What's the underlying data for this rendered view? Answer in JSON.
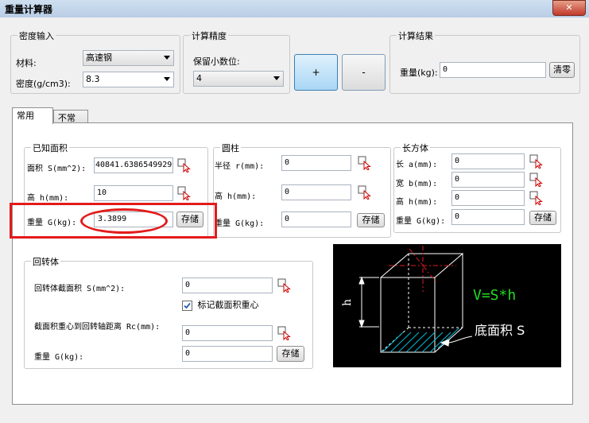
{
  "window": {
    "title": "重量计算器",
    "close": "✕"
  },
  "density": {
    "legend": "密度输入",
    "material_label": "材料:",
    "material_value": "高速钢",
    "density_label": "密度(g/cm3):",
    "density_value": "8.3"
  },
  "precision": {
    "legend": "计算精度",
    "decimals_label": "保留小数位:",
    "decimals_value": "4"
  },
  "ops": {
    "plus": "+",
    "minus": "-"
  },
  "result": {
    "legend": "计算结果",
    "weight_label": "重量(kg):",
    "weight_value": "0",
    "clear_label": "清零"
  },
  "tabs": [
    {
      "label": "常用"
    },
    {
      "label": "不常用"
    }
  ],
  "known_area": {
    "legend": "已知面积",
    "area_label": "面积 S(mm^2):",
    "area_value": "40841.6386549929",
    "height_label": "高 h(mm):",
    "height_value": "10",
    "weight_label": "重量 G(kg):",
    "weight_value": "3.3899",
    "save_label": "存储"
  },
  "cylinder": {
    "legend": "圆柱",
    "radius_label": "半径 r(mm):",
    "radius_value": "0",
    "height_label": "高 h(mm):",
    "height_value": "0",
    "weight_label": "重量 G(kg):",
    "weight_value": "0",
    "save_label": "存储"
  },
  "cuboid": {
    "legend": "长方体",
    "length_label": "长 a(mm):",
    "length_value": "0",
    "width_label": "宽 b(mm):",
    "width_value": "0",
    "height_label": "高 h(mm):",
    "height_value": "0",
    "weight_label": "重量 G(kg):",
    "weight_value": "0",
    "save_label": "存储"
  },
  "revolution": {
    "legend": "回转体",
    "section_label": "回转体截面积 S(mm^2):",
    "section_value": "0",
    "mark_label": "标记截面积重心",
    "mark_checked": true,
    "distance_label": "截面积重心到回转轴距离 Rc(mm):",
    "distance_value": "0",
    "weight_label": "重量 G(kg):",
    "weight_value": "0",
    "save_label": "存储"
  },
  "diagram": {
    "formula": "V=S*h",
    "base_area": "底面积 S",
    "height_mark": "h"
  },
  "colors": {
    "highlight_red": "#e31b1b",
    "formula_green": "#22dd22",
    "hatch_cyan": "#00bcd4"
  }
}
